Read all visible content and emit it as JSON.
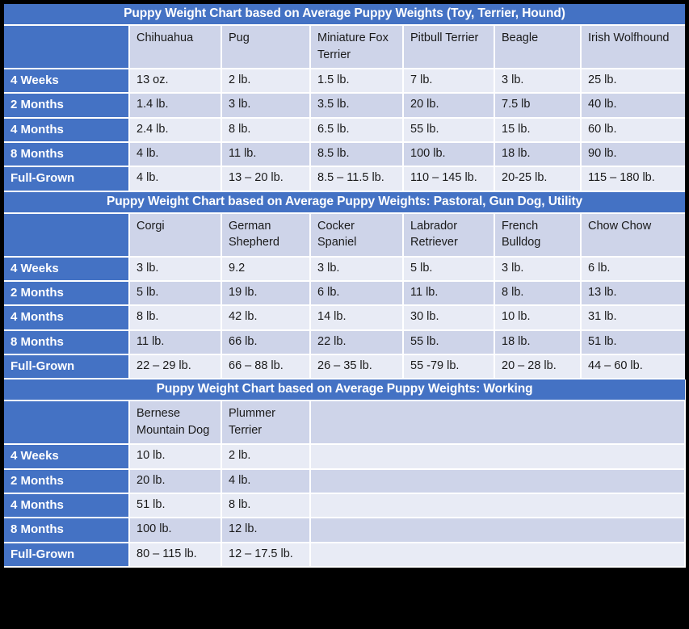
{
  "colors": {
    "accent_blue": "#4472C4",
    "row_shade_dark": "#CED4E9",
    "row_shade_light": "#E8EBF5",
    "page_border": "#000000",
    "header_text": "#FFFFFF"
  },
  "row_labels": [
    "4 Weeks",
    "2 Months",
    "4 Months",
    "8 Months",
    "Full-Grown"
  ],
  "tables": [
    {
      "title": "Puppy Weight Chart based on Average Puppy Weights (Toy, Terrier, Hound)",
      "breeds": [
        "Chihuahua",
        "Pug",
        "Miniature Fox Terrier",
        "Pitbull Terrier",
        "Beagle",
        "Irish Wolfhound"
      ],
      "rows": [
        {
          "label": "4 Weeks",
          "values": [
            "13 oz.",
            "2 lb.",
            "1.5 lb.",
            "7 lb.",
            "3 lb.",
            "25 lb."
          ]
        },
        {
          "label": "2 Months",
          "values": [
            "1.4 lb.",
            "3 lb.",
            "3.5 lb.",
            "20 lb.",
            "7.5 lb",
            "40 lb."
          ]
        },
        {
          "label": "4 Months",
          "values": [
            "2.4 lb.",
            "8 lb.",
            "6.5 lb.",
            "55 lb.",
            "15 lb.",
            "60 lb."
          ]
        },
        {
          "label": "8 Months",
          "values": [
            "4 lb.",
            "11 lb.",
            "8.5 lb.",
            "100 lb.",
            "18 lb.",
            "90 lb."
          ]
        },
        {
          "label": "Full-Grown",
          "values": [
            "4 lb.",
            "13 – 20 lb.",
            "8.5 – 11.5 lb.",
            "110 – 145 lb.",
            "20-25 lb.",
            "115 – 180 lb."
          ]
        }
      ]
    },
    {
      "title": "Puppy Weight Chart based on Average Puppy Weights: Pastoral, Gun Dog, Utility",
      "breeds": [
        "Corgi",
        "German Shepherd",
        "Cocker Spaniel",
        "Labrador Retriever",
        "French Bulldog",
        "Chow Chow"
      ],
      "rows": [
        {
          "label": "4 Weeks",
          "values": [
            "3 lb.",
            "9.2",
            "3 lb.",
            "5 lb.",
            "3 lb.",
            "6 lb."
          ]
        },
        {
          "label": "2 Months",
          "values": [
            "5 lb.",
            "19 lb.",
            "6 lb.",
            "11 lb.",
            "8 lb.",
            "13 lb."
          ]
        },
        {
          "label": "4 Months",
          "values": [
            "8 lb.",
            "42 lb.",
            "14 lb.",
            "30 lb.",
            "10 lb.",
            "31 lb."
          ]
        },
        {
          "label": "8 Months",
          "values": [
            "11 lb.",
            "66 lb.",
            "22 lb.",
            "55 lb.",
            "18 lb.",
            "51 lb."
          ]
        },
        {
          "label": "Full-Grown",
          "values": [
            "22 – 29 lb.",
            "66 – 88 lb.",
            "26 – 35 lb.",
            "55 -79 lb.",
            "20 – 28 lb.",
            "44 – 60 lb."
          ]
        }
      ]
    },
    {
      "title": "Puppy Weight Chart based on Average Puppy Weights: Working",
      "breeds": [
        "Bernese Mountain Dog",
        "Plummer Terrier",
        "",
        "",
        "",
        ""
      ],
      "rows": [
        {
          "label": "4 Weeks",
          "values": [
            "10 lb.",
            "2 lb.",
            "",
            "",
            "",
            ""
          ]
        },
        {
          "label": "2 Months",
          "values": [
            "20 lb.",
            "4 lb.",
            "",
            "",
            "",
            ""
          ]
        },
        {
          "label": "4 Months",
          "values": [
            "51 lb.",
            "8 lb.",
            "",
            "",
            "",
            ""
          ]
        },
        {
          "label": "8 Months",
          "values": [
            "100 lb.",
            "12 lb.",
            "",
            "",
            "",
            ""
          ]
        },
        {
          "label": "Full-Grown",
          "values": [
            "80 – 115 lb.",
            "12 – 17.5 lb.",
            "",
            "",
            "",
            ""
          ]
        }
      ]
    }
  ]
}
